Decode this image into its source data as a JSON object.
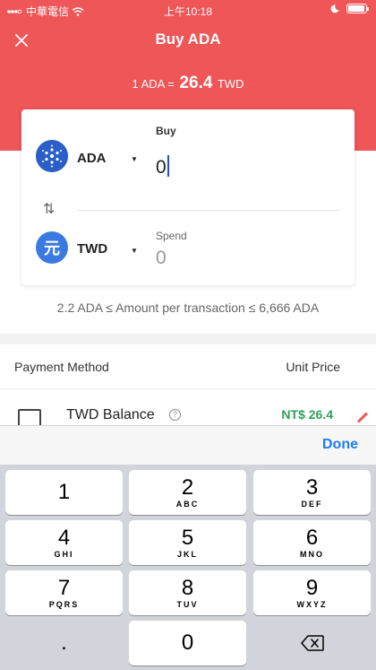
{
  "status": {
    "carrier": "中華電信",
    "time": "上午10:18"
  },
  "header": {
    "title": "Buy ADA",
    "rate_prefix": "1 ADA =",
    "rate_value": "26.4",
    "rate_suffix": "TWD"
  },
  "card": {
    "buy": {
      "currency": "ADA",
      "label": "Buy",
      "amount": "0"
    },
    "spend": {
      "currency": "TWD",
      "label": "Spend",
      "amount": "0",
      "coin_glyph": "元"
    }
  },
  "limits": "2.2 ADA ≤ Amount per transaction ≤ 6,666 ADA",
  "payment": {
    "header_left": "Payment Method",
    "header_right": "Unit Price",
    "method_name": "TWD Balance",
    "method_price": "NT$ 26.4"
  },
  "toolbar": {
    "done_label": "Done"
  },
  "keypad": [
    {
      "num": "1",
      "sub": ""
    },
    {
      "num": "2",
      "sub": "ABC"
    },
    {
      "num": "3",
      "sub": "DEF"
    },
    {
      "num": "4",
      "sub": "GHI"
    },
    {
      "num": "5",
      "sub": "JKL"
    },
    {
      "num": "6",
      "sub": "MNO"
    },
    {
      "num": "7",
      "sub": "PQRS"
    },
    {
      "num": "8",
      "sub": "TUV"
    },
    {
      "num": "9",
      "sub": "WXYZ"
    },
    {
      "num": ".",
      "sub": ""
    },
    {
      "num": "0",
      "sub": ""
    }
  ],
  "colors": {
    "brand": "#ee5658",
    "accent": "#1e7cf2",
    "price": "#2fa05a"
  },
  "icons": {
    "close": "close-icon",
    "wifi": "wifi-icon",
    "moon": "moon-icon",
    "battery": "battery-icon",
    "ada": "cardano-coin-icon",
    "twd": "twd-coin-icon",
    "swap": "swap-arrows-icon",
    "help": "help-circle-icon",
    "backspace": "backspace-icon"
  }
}
